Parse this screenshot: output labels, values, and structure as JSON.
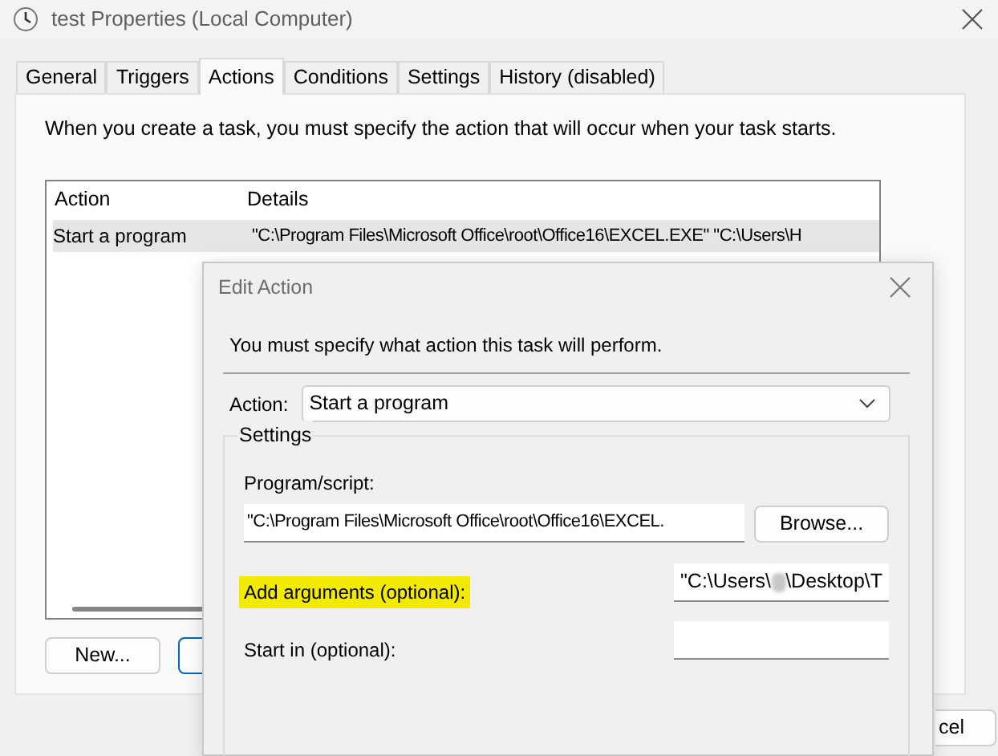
{
  "window": {
    "title": "test Properties (Local Computer)"
  },
  "tabs": [
    {
      "label": "General",
      "selected": false
    },
    {
      "label": "Triggers",
      "selected": false
    },
    {
      "label": "Actions",
      "selected": true
    },
    {
      "label": "Conditions",
      "selected": false
    },
    {
      "label": "Settings",
      "selected": false
    },
    {
      "label": "History (disabled)",
      "selected": false
    }
  ],
  "description": "When you create a task, you must specify the action that will occur when your task starts.",
  "actions_table": {
    "columns": [
      "Action",
      "Details"
    ],
    "rows": [
      {
        "cells": [
          "Start a program",
          "\"C:\\Program Files\\Microsoft Office\\root\\Office16\\EXCEL.EXE\" \"C:\\Users\\H"
        ],
        "selected": true
      }
    ]
  },
  "buttons": [
    "New..."
  ],
  "cancel_button": "cel",
  "edit_dialog": {
    "title": "Edit Action",
    "description": "You must specify what action this task will perform.",
    "action_label": "Action:",
    "action_value": "Start a program",
    "settings_legend": "Settings",
    "program_label": "Program/script:",
    "program_value": "\"C:\\Program Files\\Microsoft Office\\root\\Office16\\EXCEL.",
    "browse_button": "Browse...",
    "arguments_label": "Add arguments (optional):",
    "arguments_highlighted": true,
    "arguments_value": [
      "\"C:\\Users\\",
      "\\Desktop\\T"
    ],
    "start_in_label": "Start in (optional):"
  }
}
